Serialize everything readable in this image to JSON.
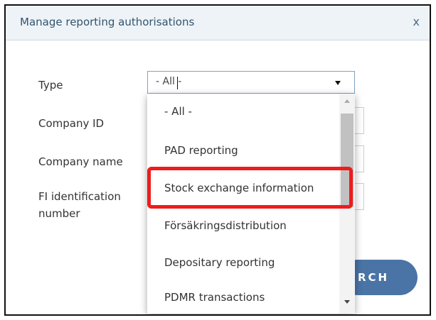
{
  "dialog": {
    "title": "Manage reporting authorisations",
    "close_label": "x"
  },
  "form": {
    "type_label": "Type",
    "company_id_label": "Company ID",
    "company_name_label": "Company name",
    "fi_id_label_line1": "FI identification",
    "fi_id_label_line2": "number",
    "type_value": "- All -"
  },
  "dropdown": {
    "options": [
      "- All -",
      "PAD reporting",
      "Stock exchange information",
      "Försäkringsdistribution",
      "Depositary reporting",
      "PDMR transactions"
    ],
    "highlighted_option": "Stock exchange information"
  },
  "search_button": {
    "label": "RCH"
  },
  "colors": {
    "header_bg": "#eef3f8",
    "title_text": "#33546e",
    "select_border": "#7fa2c4",
    "button_bg": "#4a74a6",
    "highlight": "#ee1c1c"
  }
}
